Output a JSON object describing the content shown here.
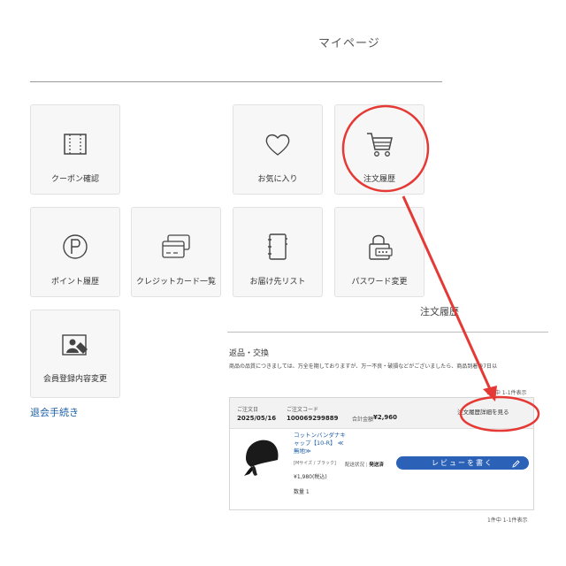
{
  "page": {
    "title": "マイページ"
  },
  "tiles": {
    "coupon": "クーポン確認",
    "favorites": "お気に入り",
    "order_history": "注文履歴",
    "points": "ポイント履歴",
    "credit_cards": "クレジットカード一覧",
    "addresses": "お届け先リスト",
    "password": "パスワード変更",
    "member_info": "会員登録内容変更"
  },
  "withdraw_link": "退会手続き",
  "order_panel": {
    "title": "注文履歴",
    "returns_title": "返品・交換",
    "returns_text": "商品の品質につきましては、万全を期しておりますが、万一不良・破損などがございましたら、商品到着後7日以",
    "count_top": "1件中 1-1件表示",
    "count_bottom": "1件中 1-1件表示",
    "order": {
      "date_label": "ご注文日",
      "date": "2025/05/16",
      "code_label": "ご注文コード",
      "code": "100069299889",
      "total_label": "合計金額",
      "total": "¥2,960",
      "detail_button": "注文履歴詳細を見る",
      "product_name": "コットンバンダナキャップ【10-R】 ≪無地≫",
      "variant": "[Mサイズ / ブラック]",
      "price": "¥1,980(税込)",
      "quantity": "数量 1",
      "ship_label": "配送状況",
      "ship_status": "発送済",
      "review_button": "レビューを書く"
    }
  },
  "colors": {
    "accent": "#2b62b8",
    "link": "#1d5fa8",
    "annotation": "#e53935"
  },
  "icons": [
    "ticket-icon",
    "heart-icon",
    "cart-icon",
    "point-icon",
    "credit-card-icon",
    "address-book-icon",
    "lock-icon",
    "profile-icon",
    "pencil-icon"
  ]
}
